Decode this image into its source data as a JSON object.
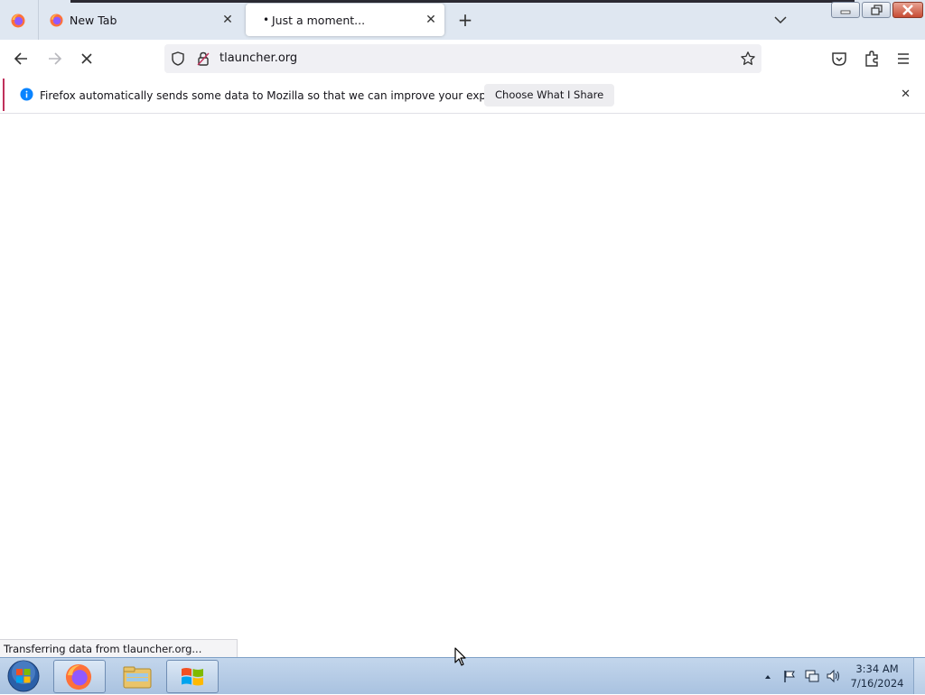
{
  "browser": {
    "tabs": [
      {
        "title": "New Tab",
        "active": false
      },
      {
        "title": "Just a moment...",
        "active": true,
        "indicator": "•"
      }
    ],
    "new_tab_symbol": "+",
    "close_symbol": "✕"
  },
  "navbar": {
    "url": "tlauncher.org",
    "loading": true
  },
  "notification": {
    "message": "Firefox automatically sends some data to Mozilla so that we can improve your experience.",
    "button_label": "Choose What I Share",
    "close_symbol": "✕"
  },
  "status": {
    "text": "Transferring data from tlauncher.org..."
  },
  "taskbar": {
    "time": "3:34 AM",
    "date": "7/16/2024"
  },
  "colors": {
    "notification_accent": "#c0305b",
    "info_icon": "#0a84ff",
    "firefox_orange": "#ff7139"
  }
}
